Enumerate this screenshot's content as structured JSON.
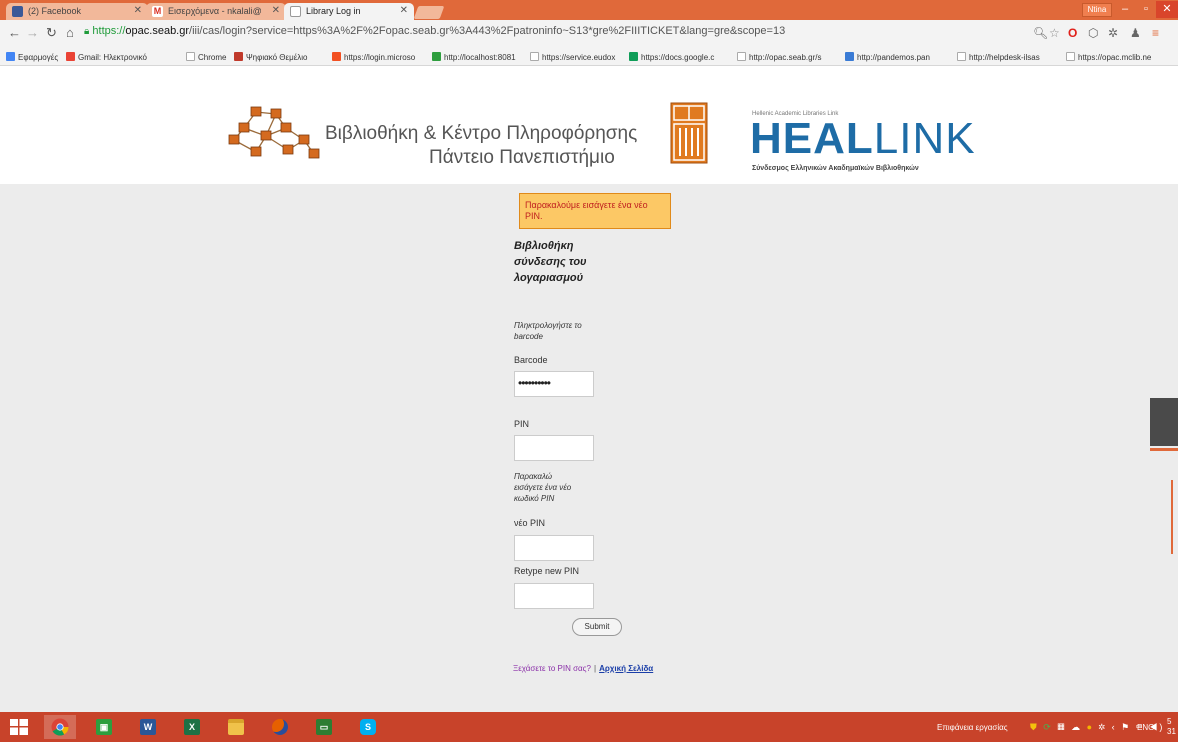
{
  "browser": {
    "tabs": [
      {
        "label": "(2) Facebook",
        "icon": "facebook-icon",
        "color": "#3b5998",
        "active": false
      },
      {
        "label": "Εισερχόμενα - nkalali@",
        "icon": "gmail-icon",
        "color": "#d93025",
        "active": false
      },
      {
        "label": "Library Log in",
        "icon": "page-icon",
        "color": "#dddddd",
        "active": true
      }
    ],
    "user_badge": "Ntina",
    "url_https": "https://",
    "url_host": "opac.seab.gr",
    "url_path": "/iii/cas/login?service=https%3A%2F%2Fopac.seab.gr%3A443%2Fpatroninfo~S13*gre%2FIIITICKET&lang=gre&scope=13",
    "bookmarks": [
      {
        "label": "Εφαρμογές",
        "icon": "apps-icon",
        "color": "#4285f4"
      },
      {
        "label": "Gmail: Ηλεκτρονικό",
        "icon": "google-icon",
        "color": "#ea4335"
      },
      {
        "label": "Chrome",
        "icon": "page-icon",
        "color": "#cccccc"
      },
      {
        "label": "Ψηφιακό Θεμέλιο",
        "icon": "red-square-icon",
        "color": "#c0392b"
      },
      {
        "label": "https://login.microso",
        "icon": "microsoft-icon",
        "color": "#f25022"
      },
      {
        "label": "http://localhost:8081",
        "icon": "green-square-icon",
        "color": "#2e9e3e"
      },
      {
        "label": "https://service.eudox",
        "icon": "page-icon",
        "color": "#cccccc"
      },
      {
        "label": "https://docs.google.c",
        "icon": "sheets-icon",
        "color": "#0f9d58"
      },
      {
        "label": "http://opac.seab.gr/s",
        "icon": "page-icon",
        "color": "#cccccc"
      },
      {
        "label": "http://pandemos.pan",
        "icon": "pandemos-icon",
        "color": "#3a7bd5"
      },
      {
        "label": "http://helpdesk-ilsas",
        "icon": "page-icon",
        "color": "#cccccc"
      },
      {
        "label": "https://opac.mclib.ne",
        "icon": "page-icon",
        "color": "#cccccc"
      }
    ]
  },
  "header": {
    "library_line1": "Βιβλιοθήκη & Κέντρο Πληροφόρησης",
    "library_line2": "Πάντειο Πανεπιστήμιο",
    "heal_small": "Hellenic Academic Libraries Link",
    "heal_bold": "HEAL",
    "heal_thin": "LINK",
    "heal_sub": "Σύνδεσμος Ελληνικών Ακαδημαϊκών Βιβλιοθηκών"
  },
  "form": {
    "alert": "Παρακαλούμε εισάγετε ένα νέο PIN.",
    "title": "Βιβλιοθήκη σύνδεσης του λογαριασμού",
    "barcode_prompt": "Πληκτρολογήστε το barcode",
    "barcode_label": "Barcode",
    "barcode_value": "••••••••••",
    "pin_label": "PIN",
    "pin_value": "",
    "new_pin_prompt": "Παρακαλώ εισάγετε ένα νέο κωδικό PIN",
    "new_pin_label": "νέο PIN",
    "new_pin_value": "",
    "retype_label": "Retype new PIN",
    "retype_value": "",
    "submit_label": "Submit",
    "forgot_link": "Ξεχάσετε το PIN σας?",
    "separator": "|",
    "home_link": "Αρχική Σελίδα"
  },
  "taskbar": {
    "apps": [
      {
        "name": "chrome",
        "icon": "chrome-icon",
        "color": "#4285f4",
        "glyph": "",
        "active": true
      },
      {
        "name": "store",
        "icon": "store-icon",
        "color": "#2e9e3e",
        "glyph": "▣",
        "active": false
      },
      {
        "name": "word",
        "icon": "word-icon",
        "color": "#2b5797",
        "glyph": "W",
        "active": false
      },
      {
        "name": "excel",
        "icon": "excel-icon",
        "color": "#1e7145",
        "glyph": "X",
        "active": false
      },
      {
        "name": "file-explorer",
        "icon": "folder-icon",
        "color": "#f0c24a",
        "glyph": "",
        "active": false
      },
      {
        "name": "firefox",
        "icon": "firefox-icon",
        "color": "#e66000",
        "glyph": "",
        "active": false
      },
      {
        "name": "remote-desktop",
        "icon": "monitor-icon",
        "color": "#2e7d32",
        "glyph": "▭",
        "active": false
      },
      {
        "name": "skype",
        "icon": "skype-icon",
        "color": "#00aff0",
        "glyph": "S",
        "active": false
      }
    ],
    "desktop_label": "Επιφάνεια εργασίας",
    "language": "ENG",
    "clock": "5\n31"
  }
}
